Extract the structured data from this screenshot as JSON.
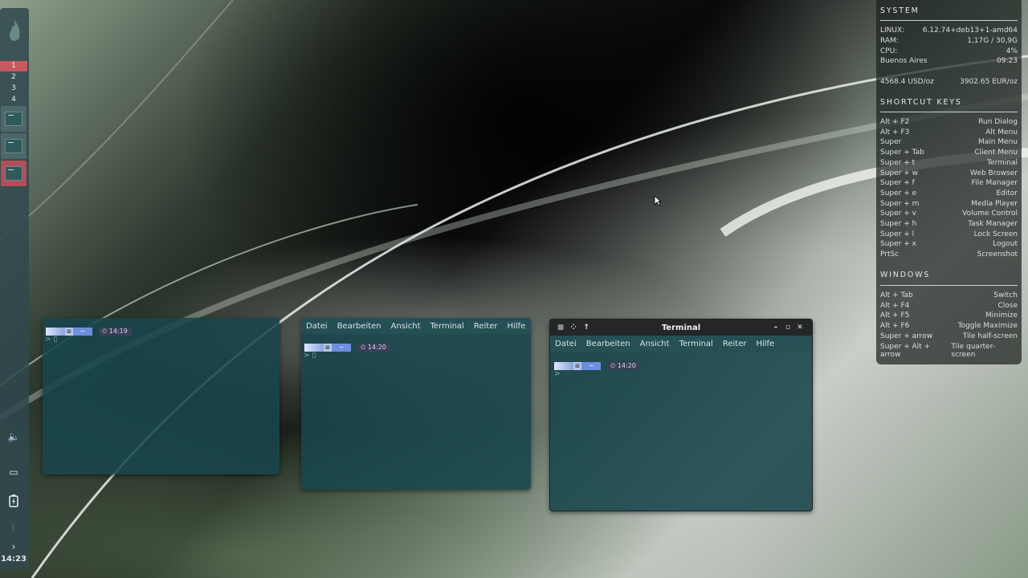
{
  "dock": {
    "workspaces": [
      "1",
      "2",
      "3",
      "4"
    ],
    "active_workspace": "1",
    "apps": [
      "terminal",
      "terminal",
      "terminal"
    ],
    "clock": "14:23",
    "icons": [
      "flame-icon",
      "volume-icon",
      "window-icon",
      "battery-charging-icon",
      "bluetooth-icon",
      "chevron-right-icon"
    ]
  },
  "windows": [
    {
      "prompt_time": "14:19",
      "home": "~",
      "cursor": ">"
    },
    {
      "menu": [
        "Datei",
        "Bearbeiten",
        "Ansicht",
        "Terminal",
        "Reiter",
        "Hilfe"
      ],
      "prompt_time": "14:20",
      "home": "~",
      "cursor": ">"
    },
    {
      "title": "Terminal",
      "menu": [
        "Datei",
        "Bearbeiten",
        "Ansicht",
        "Terminal",
        "Reiter",
        "Hilfe"
      ],
      "prompt_time": "14:20",
      "home": "~",
      "cursor": ">"
    }
  ],
  "conky": {
    "system": {
      "heading": "SYSTEM",
      "rows": [
        {
          "label": "LINUX:",
          "value": "6.12.74+deb13+1-amd64"
        },
        {
          "label": "RAM:",
          "value": "1,17G / 30,9G"
        },
        {
          "label": "CPU:",
          "value": "4%"
        },
        {
          "label": "Buenos Aires",
          "value": "09:23"
        }
      ],
      "gold": {
        "usd": "4568.4 USD/oz",
        "eur": "3902.65 EUR/oz"
      }
    },
    "shortcuts": {
      "heading": "SHORTCUT KEYS",
      "rows": [
        {
          "key": "Alt + F2",
          "action": "Run Dialog"
        },
        {
          "key": "Alt + F3",
          "action": "Alt Menu"
        },
        {
          "key": "Super",
          "action": "Main Menu"
        },
        {
          "key": "Super + Tab",
          "action": "Client Menu"
        },
        {
          "key": "Super + t",
          "action": "Terminal"
        },
        {
          "key": "Super + w",
          "action": "Web Browser"
        },
        {
          "key": "Super + f",
          "action": "File Manager"
        },
        {
          "key": "Super + e",
          "action": "Editor"
        },
        {
          "key": "Super + m",
          "action": "Media Player"
        },
        {
          "key": "Super + v",
          "action": "Volume Control"
        },
        {
          "key": "Super + h",
          "action": "Task Manager"
        },
        {
          "key": "Super + l",
          "action": "Lock Screen"
        },
        {
          "key": "Super + x",
          "action": "Logout"
        },
        {
          "key": "PrtSc",
          "action": "Screenshot"
        }
      ]
    },
    "windows": {
      "heading": "WINDOWS",
      "rows": [
        {
          "key": "Alt + Tab",
          "action": "Switch"
        },
        {
          "key": "Alt + F4",
          "action": "Close"
        },
        {
          "key": "Alt + F5",
          "action": "Minimize"
        },
        {
          "key": "Alt + F6",
          "action": "Toggle Maximize"
        },
        {
          "key": "Super + arrow",
          "action": "Tile half-screen"
        },
        {
          "key": "Super + Alt + arrow",
          "action": "Tile quarter-screen"
        }
      ]
    }
  },
  "colors": {
    "active_workspace": "#c65a5f",
    "terminal_bg": "#17464c",
    "dock_bg": "#30484e"
  }
}
